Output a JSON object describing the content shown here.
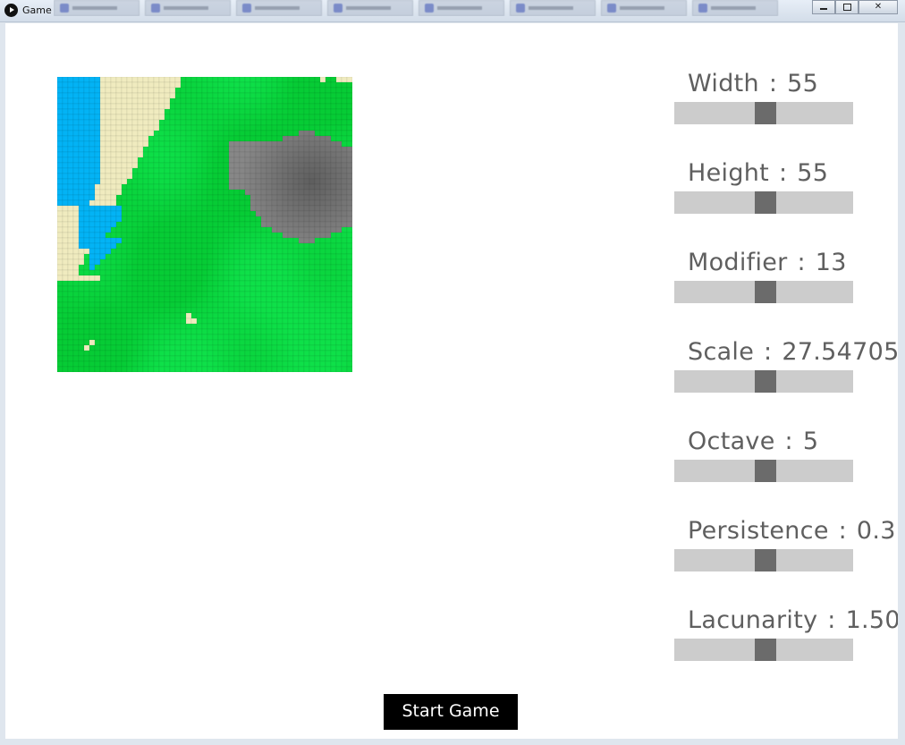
{
  "window": {
    "title": "Game",
    "controls": [
      "minimize-icon",
      "maximize-icon",
      "close-icon"
    ]
  },
  "map": {
    "grid_size": 55,
    "colors": {
      "grass": "#0ad63f",
      "sand": "#f0ebbf",
      "water": "#03b3f5",
      "rock": "#777777",
      "grid_line": "#06a833"
    }
  },
  "params": [
    {
      "key": "width",
      "label": "Width",
      "separator": ":",
      "value": "55",
      "slider_fraction": 0.5
    },
    {
      "key": "height",
      "label": "Height",
      "separator": ":",
      "value": "55",
      "slider_fraction": 0.5
    },
    {
      "key": "modifier",
      "label": "Modifier",
      "separator": ":",
      "value": "13",
      "slider_fraction": 0.5
    },
    {
      "key": "scale",
      "label": "Scale",
      "separator": ":",
      "value": "27.547058",
      "slider_fraction": 0.5
    },
    {
      "key": "octave",
      "label": "Octave",
      "separator": ":",
      "value": "5",
      "slider_fraction": 0.5
    },
    {
      "key": "persistence",
      "label": "Persistence",
      "separator": ":",
      "value": "0.3",
      "slider_fraction": 0.5
    },
    {
      "key": "lacunarity",
      "label": "Lacunarity",
      "separator": ":",
      "value": "1.50",
      "slider_fraction": 0.5
    }
  ],
  "start_button": {
    "label": "Start Game"
  },
  "colors": {
    "label_text": "#5f5f5f",
    "slider_track": "#cccccc",
    "slider_thumb": "#6b6b6b",
    "button_bg": "#000000",
    "button_text": "#ffffff"
  }
}
